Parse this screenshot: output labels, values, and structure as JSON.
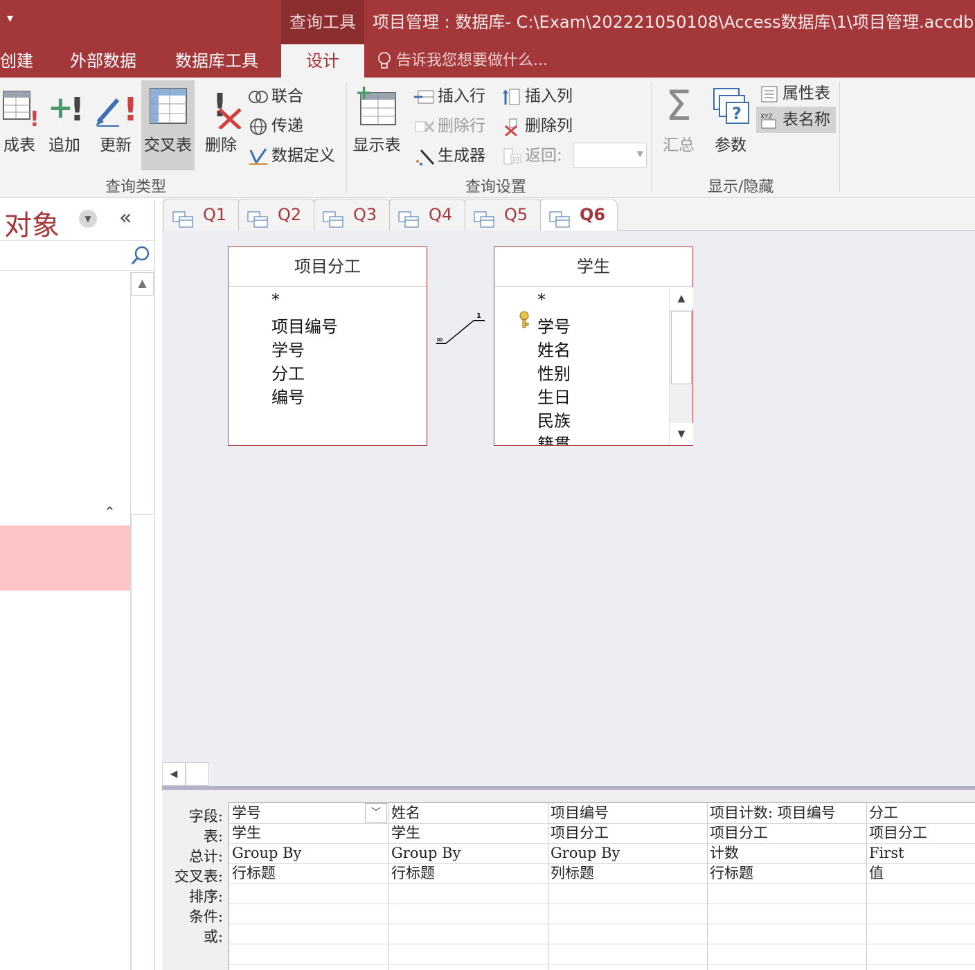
{
  "titlebar": {
    "qat_glyph": "▾",
    "context_tab": "查询工具",
    "window_title": "项目管理 : 数据库- C:\\Exam\\202221050108\\Access数据库\\1\\项目管理.accdb (Ac"
  },
  "ribbon_tabs": {
    "create": "创建",
    "external": "外部数据",
    "dbtools": "数据库工具",
    "design": "设计",
    "tellme": "告诉我您想要做什么..."
  },
  "ribbon": {
    "query_type": {
      "label": "查询类型",
      "make_table": "成表",
      "append": "追加",
      "update": "更新",
      "crosstab": "交叉表",
      "delete": "删除",
      "union": "联合",
      "passthrough": "传递",
      "data_definition": "数据定义"
    },
    "query_setup": {
      "label": "查询设置",
      "show_table": "显示表",
      "insert_rows": "插入行",
      "delete_rows": "删除行",
      "builder": "生成器",
      "insert_columns": "插入列",
      "delete_columns": "删除列",
      "return": "返回:",
      "return_value": ""
    },
    "show_hide": {
      "label": "显示/隐藏",
      "totals": "汇总",
      "parameters": "参数",
      "property_sheet": "属性表",
      "table_names": "表名称"
    }
  },
  "nav": {
    "title": "对象",
    "collapse_glyph": "«",
    "search_placeholder": ""
  },
  "doc_tabs": [
    "Q1",
    "Q2",
    "Q3",
    "Q4",
    "Q5",
    "Q6"
  ],
  "active_tab": "Q6",
  "tables": [
    {
      "name": "项目分工",
      "fields": [
        "*",
        "项目编号",
        "学号",
        "分工",
        "编号"
      ]
    },
    {
      "name": "学生",
      "fields": [
        "*",
        "学号",
        "姓名",
        "性别",
        "生日",
        "民族",
        "籍贯"
      ],
      "primary_key": "学号"
    }
  ],
  "relationship": {
    "one": "1",
    "many": "∞"
  },
  "qbe": {
    "row_labels": [
      "字段:",
      "表:",
      "总计:",
      "交叉表:",
      "排序:",
      "条件:",
      "或:"
    ],
    "columns": [
      {
        "field": "学号",
        "table": "学生",
        "total": "Group By",
        "crosstab": "行标题"
      },
      {
        "field": "姓名",
        "table": "学生",
        "total": "Group By",
        "crosstab": "行标题"
      },
      {
        "field": "项目编号",
        "table": "项目分工",
        "total": "Group By",
        "crosstab": "列标题"
      },
      {
        "field": "项目计数: 项目编号",
        "table": "项目分工",
        "total": "计数",
        "crosstab": "行标题"
      },
      {
        "field": "分工",
        "table": "项目分工",
        "total": "First",
        "crosstab": "值"
      }
    ]
  },
  "colors": {
    "accent": "#a4373a",
    "ribbon_bg": "#f3f3f3",
    "design_bg": "#edeef1",
    "nav_highlight": "#fdc4c6"
  }
}
